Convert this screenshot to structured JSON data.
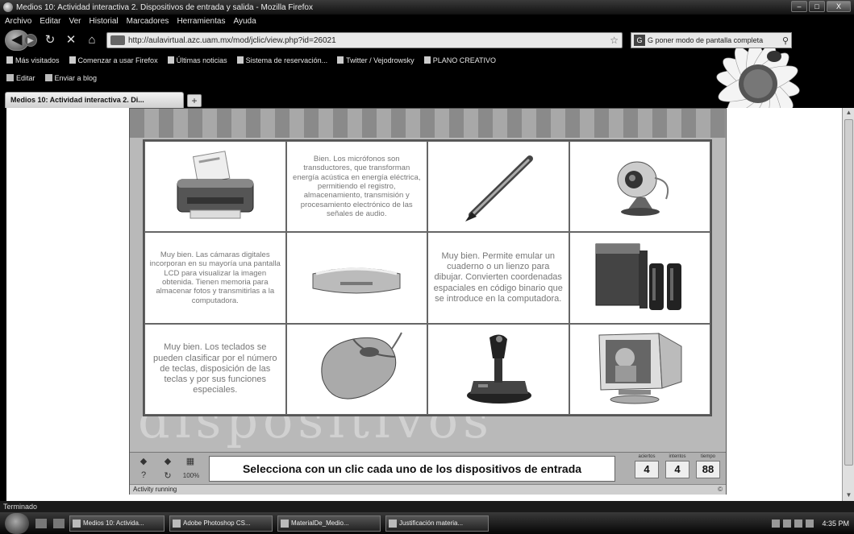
{
  "window": {
    "title": "Medios 10: Actividad interactiva 2. Dispositivos de entrada y salida - Mozilla Firefox",
    "controls": [
      "–",
      "□",
      "X"
    ]
  },
  "menu": [
    "Archivo",
    "Editar",
    "Ver",
    "Historial",
    "Marcadores",
    "Herramientas",
    "Ayuda"
  ],
  "nav": {
    "url": "http://aulavirtual.azc.uam.mx/mod/jclic/view.php?id=26021",
    "search_engine_icon": "google-icon",
    "search_text": "G poner modo de pantalla completa"
  },
  "bookmarks": [
    "Más visitados",
    "Comenzar a usar Firefox",
    "Últimas noticias",
    "Sistema de reservación...",
    "Twitter / Vejodrowsky",
    "PLANO CREATIVO"
  ],
  "toolbar2": [
    "Editar",
    "Enviar a blog"
  ],
  "tab": {
    "label": "Medios 10: Actividad interactiva 2. Di...",
    "new_tab": "+"
  },
  "activity": {
    "cells": [
      {
        "type": "image",
        "icon": "printer-icon",
        "name": "cell-printer"
      },
      {
        "type": "text",
        "size": "sm",
        "text": "Bien. Los micrófonos son transductores, que transforman energía acústica en energía eléctrica, permitiendo el registro, almacenamiento, transmisión y procesamiento electrónico de las señales de audio."
      },
      {
        "type": "image",
        "icon": "pen-icon",
        "name": "cell-pen"
      },
      {
        "type": "image",
        "icon": "webcam-icon",
        "name": "cell-webcam"
      },
      {
        "type": "text",
        "size": "sm",
        "text": "Muy bien. Las cámaras digitales incorporan en su mayoría una pantalla LCD para visualizar la imagen obtenida. Tienen memoria para almacenar fotos y transmitirlas a la computadora."
      },
      {
        "type": "image",
        "icon": "scanner-icon",
        "name": "cell-scanner"
      },
      {
        "type": "text",
        "size": "md",
        "text": "Muy bien. Permite emular un cuaderno o un lienzo para dibujar. Convierten coordenadas espaciales en código binario que se introduce en la computadora."
      },
      {
        "type": "image",
        "icon": "speakers-icon",
        "name": "cell-speakers"
      },
      {
        "type": "text",
        "size": "md",
        "text": "Muy bien. Los teclados se pueden clasificar por el número de teclas, disposición de las teclas y por sus funciones especiales."
      },
      {
        "type": "image",
        "icon": "mouse-icon",
        "name": "cell-mouse"
      },
      {
        "type": "image",
        "icon": "joystick-icon",
        "name": "cell-joystick"
      },
      {
        "type": "image",
        "icon": "monitor-icon",
        "name": "cell-monitor"
      }
    ],
    "message": "Selecciona con un clic cada uno de los dispositivos de entrada",
    "controls": {
      "prev": "◆",
      "next": "◆",
      "reports": "▦",
      "help": "?",
      "reset": "↻",
      "zoom": "100%"
    },
    "counters": [
      {
        "label": "aciertos",
        "value": "4"
      },
      {
        "label": "intentos",
        "value": "4"
      },
      {
        "label": "tiempo",
        "value": "88"
      }
    ],
    "status": "Activity running",
    "status_right": "©"
  },
  "ffstatus": "Terminado",
  "taskbar": {
    "tasks": [
      "Medios 10: Activida...",
      "Adobe Photoshop CS...",
      "MaterialDe_Medio...",
      "Justificación materia..."
    ],
    "clock": "4:35 PM"
  }
}
